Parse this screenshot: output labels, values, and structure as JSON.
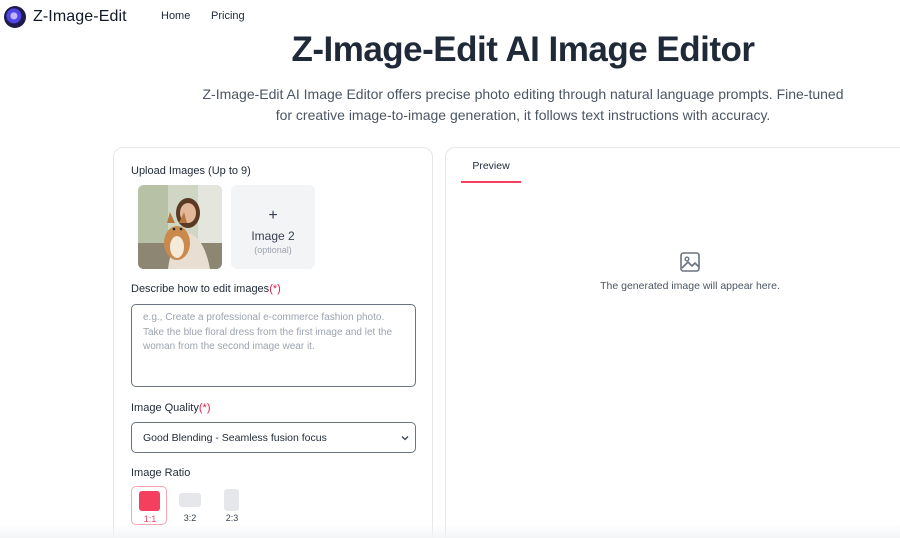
{
  "nav": {
    "brand": "Z-Image-Edit",
    "links": [
      "Home",
      "Pricing"
    ]
  },
  "hero": {
    "title": "Z-Image-Edit AI Image Editor",
    "subtitle": "Z-Image-Edit AI Image Editor offers precise photo editing through natural language prompts. Fine-tuned for creative image-to-image generation, it follows text instructions with accuracy."
  },
  "form": {
    "upload_label": "Upload Images (Up to 9)",
    "slot2": {
      "plus": "+",
      "name": "Image 2",
      "optional": "(optional)"
    },
    "prompt_label": "Describe how to edit images",
    "prompt_placeholder": "e.g., Create a professional e-commerce fashion photo. Take the blue floral dress from the first image and let the woman from the second image wear it.",
    "required_mark": "(*)",
    "quality_label": "Image Quality",
    "quality_value": "Good Blending - Seamless fusion focus",
    "ratio_label": "Image Ratio",
    "ratios": [
      "1:1",
      "3:2",
      "2:3"
    ],
    "selected_ratio": "1:1"
  },
  "preview": {
    "tab": "Preview",
    "empty_text": "The generated image will appear here.",
    "icon": "image-placeholder-icon"
  },
  "colors": {
    "accent": "#f43f5e",
    "text": "#1f2937",
    "muted": "#9ca3af"
  }
}
